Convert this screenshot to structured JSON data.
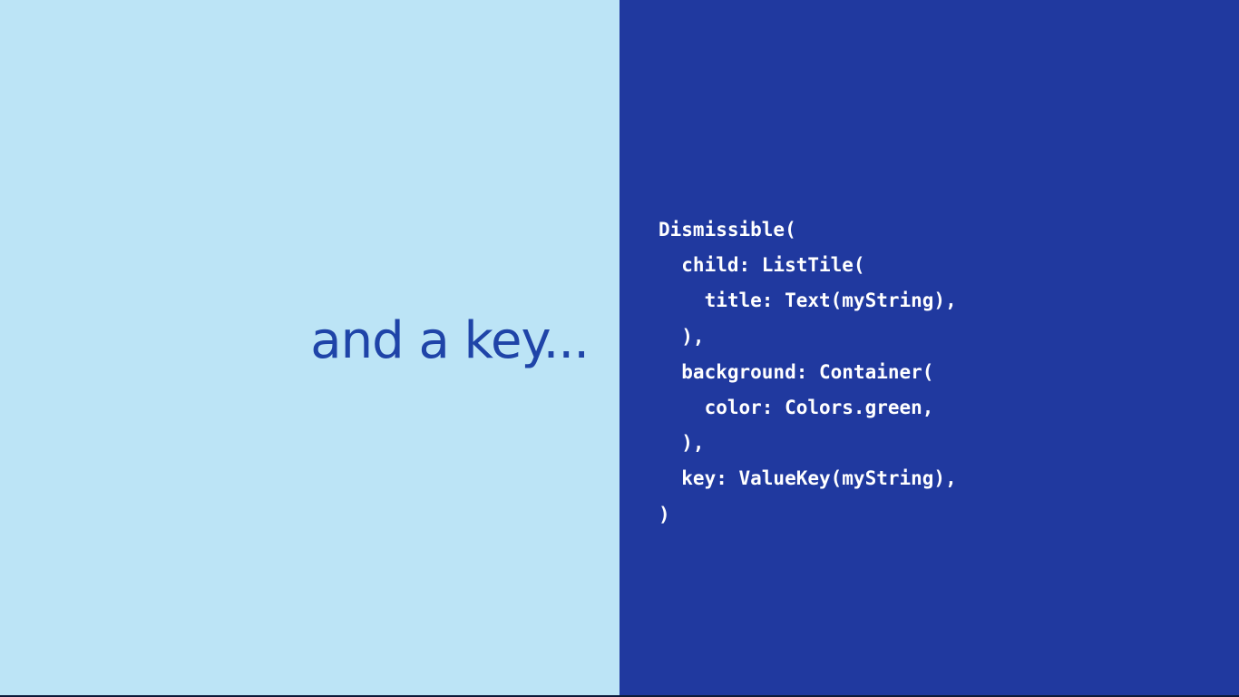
{
  "slide": {
    "headline": "and a key...",
    "code_lines": [
      "Dismissible(",
      "  child: ListTile(",
      "    title: Text(myString),",
      "  ),",
      "  background: Container(",
      "    color: Colors.green,",
      "  ),",
      "  key: ValueKey(myString),",
      ")"
    ]
  },
  "colors": {
    "left_panel_bg": "#bce4f6",
    "right_panel_bg": "#20399f",
    "headline_text": "#1f44a8",
    "code_text": "#ffffff"
  }
}
